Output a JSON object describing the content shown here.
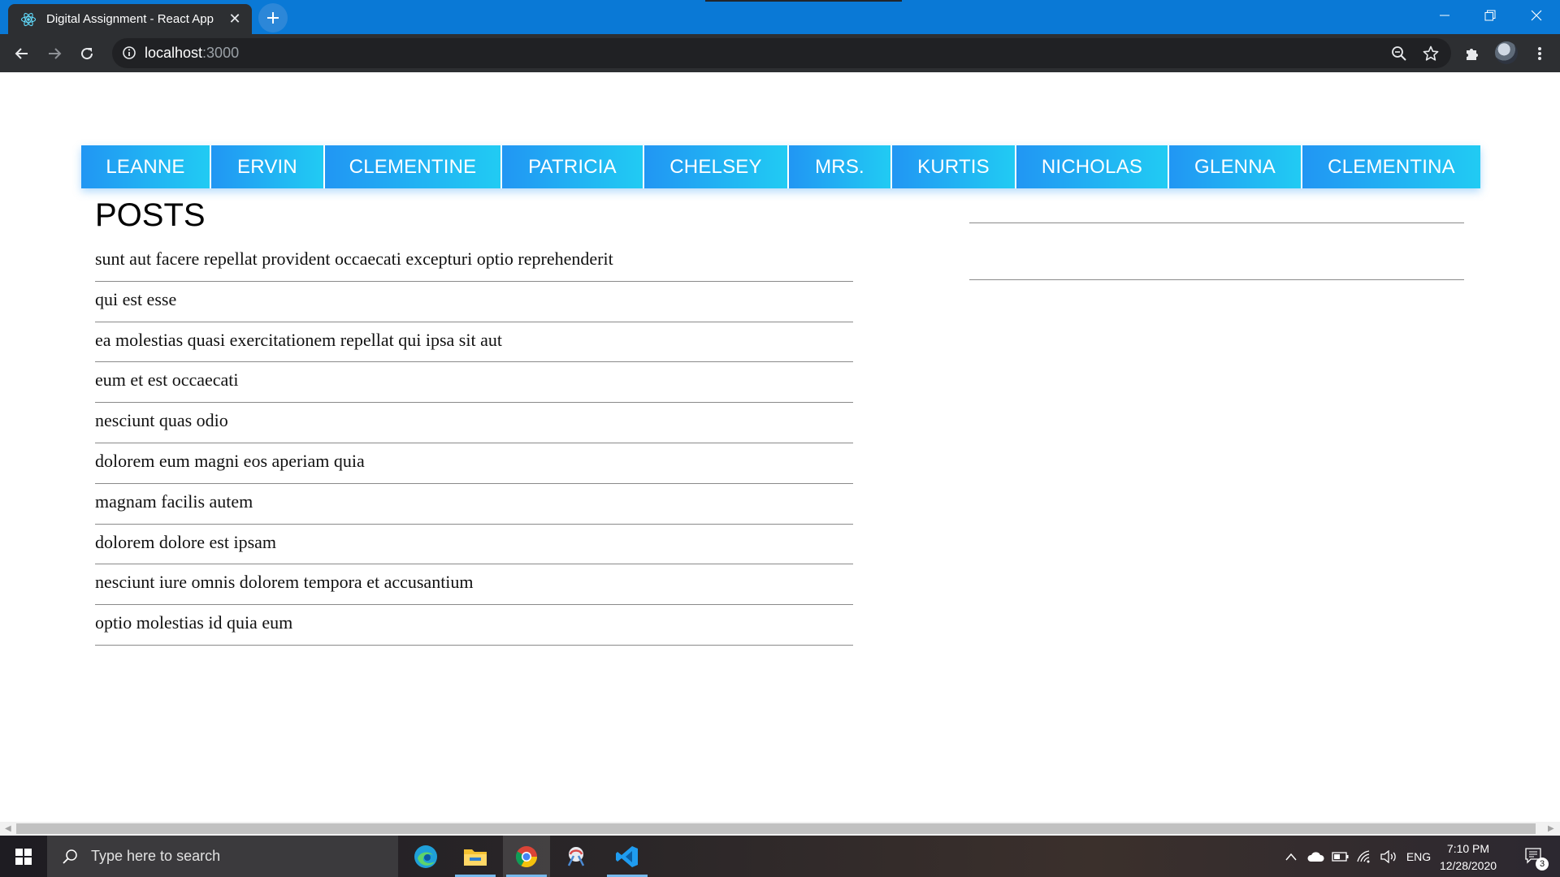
{
  "browser": {
    "tab_title": "Digital Assignment - React App",
    "url_host": "localhost",
    "url_port": ":3000"
  },
  "nav": {
    "items": [
      "LEANNE",
      "ERVIN",
      "CLEMENTINE",
      "PATRICIA",
      "CHELSEY",
      "MRS.",
      "KURTIS",
      "NICHOLAS",
      "GLENNA",
      "CLEMENTINA"
    ]
  },
  "posts": {
    "title": "POSTS",
    "items": [
      "sunt aut facere repellat provident occaecati excepturi optio reprehenderit",
      "qui est esse",
      "ea molestias quasi exercitationem repellat qui ipsa sit aut",
      "eum et est occaecati",
      "nesciunt quas odio",
      "dolorem eum magni eos aperiam quia",
      "magnam facilis autem",
      "dolorem dolore est ipsam",
      "nesciunt iure omnis dolorem tempora et accusantium",
      "optio molestias id quia eum"
    ]
  },
  "taskbar": {
    "search_placeholder": "Type here to search",
    "language": "ENG",
    "time": "7:10 PM",
    "date": "12/28/2020",
    "notification_count": "3"
  },
  "colors": {
    "tabstrip": "#0a79d6",
    "toolbar": "#2d2f32",
    "nav_gradient_start": "#2196f3",
    "nav_gradient_end": "#21cbf3"
  }
}
